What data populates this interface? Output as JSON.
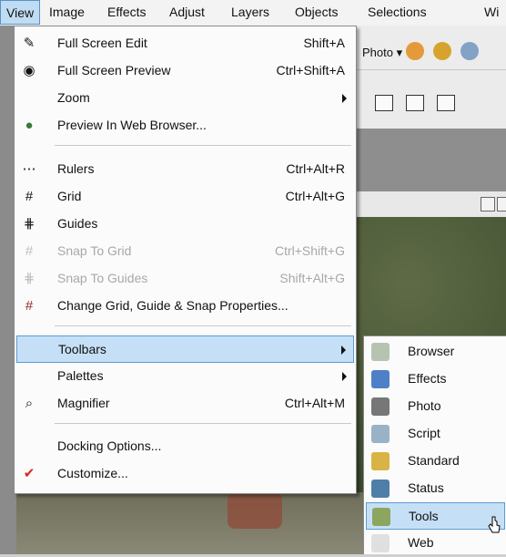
{
  "menubar": [
    "View",
    "Image",
    "Effects",
    "Adjust",
    "Layers",
    "Objects",
    "Selections",
    "Wi"
  ],
  "toolbar": {
    "photo_dropdown": "Photo"
  },
  "view_menu": [
    {
      "label": "Full Screen Edit",
      "shortcut": "Shift+A",
      "icon": "pencil-icon"
    },
    {
      "label": "Full Screen Preview",
      "shortcut": "Ctrl+Shift+A",
      "icon": "eye-icon"
    },
    {
      "label": "Zoom",
      "shortcut": "",
      "icon": ""
    },
    {
      "label": "Preview In Web Browser...",
      "shortcut": "",
      "icon": "globe-eye-icon"
    },
    {
      "label": "Rulers",
      "shortcut": "Ctrl+Alt+R",
      "icon": "ruler-icon"
    },
    {
      "label": "Grid",
      "shortcut": "Ctrl+Alt+G",
      "icon": "grid-icon"
    },
    {
      "label": "Guides",
      "shortcut": "",
      "icon": "guides-icon"
    },
    {
      "label": "Snap To Grid",
      "shortcut": "Ctrl+Shift+G",
      "icon": "snap-grid-icon"
    },
    {
      "label": "Snap To Guides",
      "shortcut": "Shift+Alt+G",
      "icon": "snap-guides-icon"
    },
    {
      "label": "Change Grid, Guide & Snap Properties...",
      "shortcut": "",
      "icon": "grid-properties-icon"
    },
    {
      "label": "Toolbars",
      "shortcut": "",
      "icon": ""
    },
    {
      "label": "Palettes",
      "shortcut": "",
      "icon": ""
    },
    {
      "label": "Magnifier",
      "shortcut": "Ctrl+Alt+M",
      "icon": "magnifier-icon"
    },
    {
      "label": "Docking Options...",
      "shortcut": "",
      "icon": ""
    },
    {
      "label": "Customize...",
      "shortcut": "",
      "icon": "check-icon"
    }
  ],
  "toolbars_submenu": [
    "Browser",
    "Effects",
    "Photo",
    "Script",
    "Standard",
    "Status",
    "Tools",
    "Web"
  ],
  "colors": {
    "highlight": "#c5e0f6",
    "highlight_border": "#5d9bd0"
  }
}
